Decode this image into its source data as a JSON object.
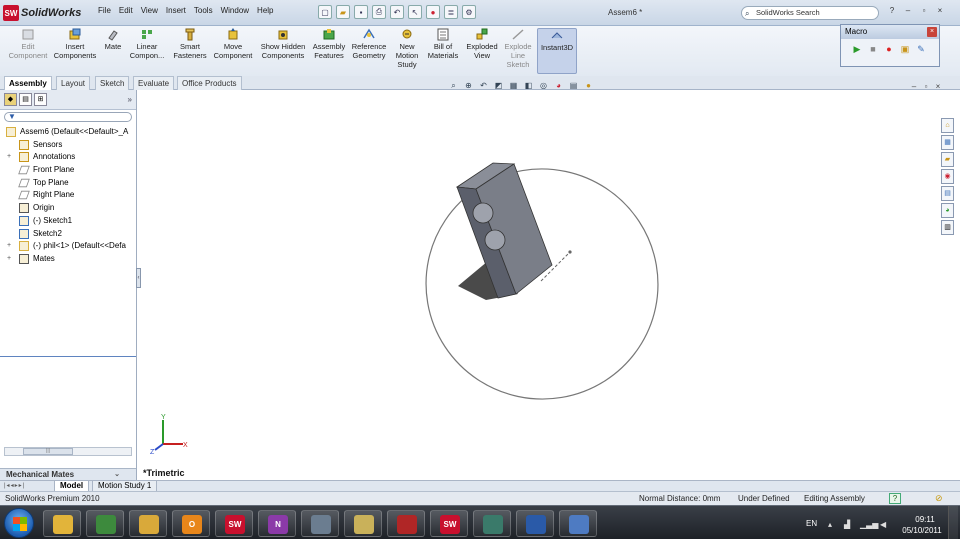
{
  "app": {
    "brand": "SolidWorks",
    "brand_mark": "SW",
    "document_title": "Assem6 *"
  },
  "menu": [
    "File",
    "Edit",
    "View",
    "Insert",
    "Tools",
    "Window",
    "Help"
  ],
  "search": {
    "placeholder": "SolidWorks Search"
  },
  "window_controls": {
    "help": "?",
    "minimize": "–",
    "restore": "▫",
    "close": "×"
  },
  "commands": [
    {
      "label": "Edit Component",
      "icon": "edit-component-icon",
      "disabled": true
    },
    {
      "label": "Insert Components",
      "icon": "insert-components-icon"
    },
    {
      "label": "Mate",
      "icon": "mate-icon"
    },
    {
      "label": "Linear Compon...",
      "icon": "linear-pattern-icon"
    },
    {
      "label": "Smart Fasteners",
      "icon": "smart-fasteners-icon"
    },
    {
      "label": "Move Component",
      "icon": "move-component-icon"
    },
    {
      "label": "Show Hidden Components",
      "icon": "show-hidden-icon"
    },
    {
      "label": "Assembly Features",
      "icon": "assembly-features-icon"
    },
    {
      "label": "Reference Geometry",
      "icon": "reference-geometry-icon"
    },
    {
      "label": "New Motion Study",
      "icon": "motion-study-icon"
    },
    {
      "label": "Bill of Materials",
      "icon": "bom-icon"
    },
    {
      "label": "Exploded View",
      "icon": "exploded-view-icon"
    },
    {
      "label": "Explode Line Sketch",
      "icon": "explode-line-icon",
      "disabled": true
    },
    {
      "label": "Instant3D",
      "icon": "instant3d-icon",
      "active": true
    }
  ],
  "macro": {
    "title": "Macro"
  },
  "tabs": [
    "Assembly",
    "Layout",
    "Sketch",
    "Evaluate",
    "Office Products"
  ],
  "active_tab": "Assembly",
  "tree": [
    {
      "label": "Assem6  (Default<<Default>_A",
      "icon": "assembly-icon",
      "level": 0,
      "expander": ""
    },
    {
      "label": "Sensors",
      "icon": "sensors-icon",
      "level": 1,
      "expander": ""
    },
    {
      "label": "Annotations",
      "icon": "annotations-icon",
      "level": 1,
      "expander": "+"
    },
    {
      "label": "Front Plane",
      "icon": "plane-icon",
      "level": 1,
      "expander": ""
    },
    {
      "label": "Top Plane",
      "icon": "plane-icon",
      "level": 1,
      "expander": ""
    },
    {
      "label": "Right Plane",
      "icon": "plane-icon",
      "level": 1,
      "expander": ""
    },
    {
      "label": "Origin",
      "icon": "origin-icon",
      "level": 1,
      "expander": ""
    },
    {
      "label": "(-) Sketch1",
      "icon": "sketch-icon",
      "level": 1,
      "expander": ""
    },
    {
      "label": "Sketch2",
      "icon": "sketch-icon",
      "level": 1,
      "expander": ""
    },
    {
      "label": "(-) phil<1> (Default<<Defa",
      "icon": "part-icon",
      "level": 1,
      "expander": "+"
    },
    {
      "label": "Mates",
      "icon": "mates-icon",
      "level": 1,
      "expander": "+"
    }
  ],
  "mechanical_mates": "Mechanical Mates",
  "view_label": "*Trimetric",
  "triad": {
    "x": "X",
    "y": "Y",
    "z": "Z"
  },
  "bottom_tabs": [
    "Model",
    "Motion Study 1"
  ],
  "status": {
    "product": "SolidWorks Premium 2010",
    "normal_distance": "Normal Distance: 0mm",
    "definition": "Under Defined",
    "mode": "Editing Assembly"
  },
  "taskbar": {
    "apps": [
      {
        "name": "explorer",
        "icon": "folder-icon",
        "color": "#e2b43a",
        "glyph": ""
      },
      {
        "name": "chrome",
        "icon": "chrome-icon",
        "color": "#3d8a3d",
        "glyph": ""
      },
      {
        "name": "file-manager",
        "icon": "explorer-icon",
        "color": "#d9a93a",
        "glyph": ""
      },
      {
        "name": "outlook",
        "icon": "outlook-icon",
        "color": "#e8861a",
        "glyph": "O"
      },
      {
        "name": "solidworks",
        "icon": "solidworks-icon",
        "color": "#c8102e",
        "glyph": "SW"
      },
      {
        "name": "onenote",
        "icon": "onenote-icon",
        "color": "#8b3aa8",
        "glyph": "N"
      },
      {
        "name": "calculator",
        "icon": "calculator-icon",
        "color": "#6b7d90",
        "glyph": ""
      },
      {
        "name": "folders",
        "icon": "folders-icon",
        "color": "#c9b15a",
        "glyph": ""
      },
      {
        "name": "network-app",
        "icon": "network-icon",
        "color": "#b02626",
        "glyph": ""
      },
      {
        "name": "solidworks-2",
        "icon": "solidworks-icon",
        "color": "#c8102e",
        "glyph": "SW"
      },
      {
        "name": "remote-app",
        "icon": "remote-icon",
        "color": "#3a7a6a",
        "glyph": ""
      },
      {
        "name": "paint-app",
        "icon": "paint-bucket-icon",
        "color": "#2a5aa8",
        "glyph": ""
      },
      {
        "name": "paint",
        "icon": "palette-icon",
        "color": "#4e7bc2",
        "glyph": ""
      }
    ],
    "language": "EN",
    "time": "09:11",
    "date": "05/10/2011"
  },
  "colors": {
    "brand_red": "#c8102e",
    "part_face": "#5b5f6b",
    "part_shadow": "#2a2a2a",
    "selection_blue": "#5f84c0"
  }
}
